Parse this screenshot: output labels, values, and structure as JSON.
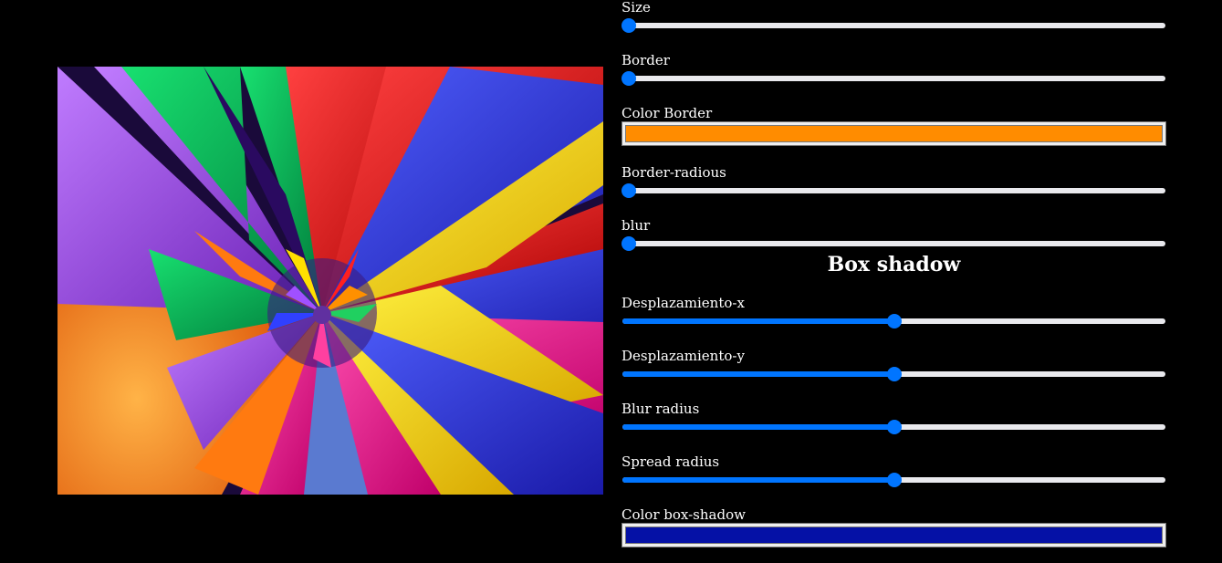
{
  "preview": {
    "description_icon": "fractal-image"
  },
  "controls": {
    "size": {
      "label": "Size",
      "value": 0
    },
    "border": {
      "label": "Border",
      "value": 0
    },
    "color_border": {
      "label": "Color Border",
      "color": "#ff8c00"
    },
    "border_radius": {
      "label": "Border-radious",
      "value": 0
    },
    "blur": {
      "label": "blur",
      "value": 0
    }
  },
  "box_shadow": {
    "heading": "Box shadow",
    "offset_x": {
      "label": "Desplazamiento-x",
      "value": 0.5
    },
    "offset_y": {
      "label": "Desplazamiento-y",
      "value": 0.5
    },
    "blur_radius": {
      "label": "Blur radius",
      "value": 0.5
    },
    "spread_radius": {
      "label": "Spread radius",
      "value": 0.5
    },
    "color": {
      "label": "Color box-shadow",
      "color": "#0511a6"
    }
  },
  "theme": {
    "accent": "#0075ff",
    "track": "#e9e9ed",
    "background": "#000000"
  }
}
